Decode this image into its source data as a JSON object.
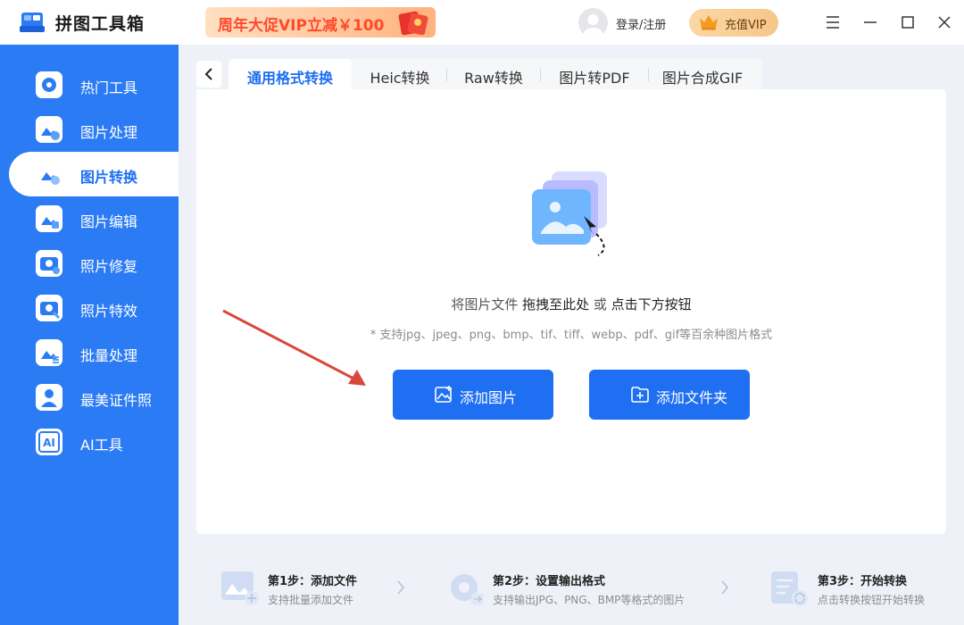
{
  "app": {
    "title": "拼图工具箱"
  },
  "promo": {
    "text": "周年大促VIP立减￥100"
  },
  "header": {
    "login_label": "登录/注册",
    "vip_label": "充值VIP"
  },
  "sidebar": {
    "items": [
      {
        "label": "热门工具",
        "icon": "tools-icon"
      },
      {
        "label": "图片处理",
        "icon": "image-process-icon"
      },
      {
        "label": "图片转换",
        "icon": "image-convert-icon",
        "active": true
      },
      {
        "label": "图片编辑",
        "icon": "image-edit-icon"
      },
      {
        "label": "照片修复",
        "icon": "photo-repair-icon"
      },
      {
        "label": "照片特效",
        "icon": "photo-effect-icon"
      },
      {
        "label": "批量处理",
        "icon": "batch-icon"
      },
      {
        "label": "最美证件照",
        "icon": "id-photo-icon"
      },
      {
        "label": "AI工具",
        "icon": "ai-icon"
      }
    ]
  },
  "tabs": [
    {
      "label": "通用格式转换",
      "active": true
    },
    {
      "label": "Heic转换"
    },
    {
      "label": "Raw转换"
    },
    {
      "label": "图片转PDF"
    },
    {
      "label": "图片合成GIF"
    }
  ],
  "main": {
    "drop_prefix": "将图片文件 ",
    "drop_drag": "拖拽至此处",
    "drop_or": " 或 ",
    "drop_click": "点击下方按钮",
    "formats_note": "* 支持jpg、jpeg、png、bmp、tif、tiff、webp、pdf、gif等百余种图片格式",
    "add_image_label": "添加图片",
    "add_folder_label": "添加文件夹"
  },
  "steps": [
    {
      "title": "第1步：添加文件",
      "desc": "支持批量添加文件"
    },
    {
      "title": "第2步：设置输出格式",
      "desc": "支持输出JPG、PNG、BMP等格式的图片"
    },
    {
      "title": "第3步：开始转换",
      "desc": "点击转换按钮开始转换"
    }
  ],
  "colors": {
    "accent": "#1f6ff2",
    "sidebar": "#2b7bf5",
    "annotation_arrow": "#d9483b"
  }
}
